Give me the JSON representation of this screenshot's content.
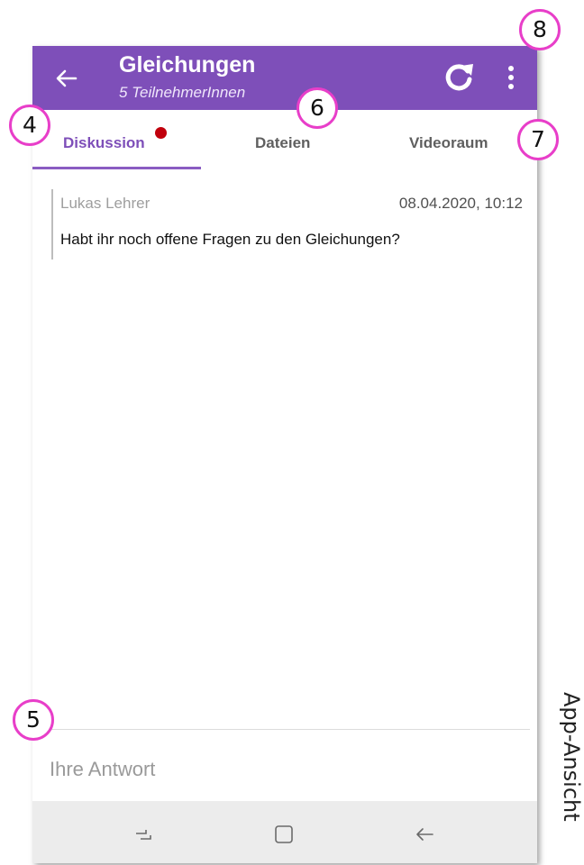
{
  "appbar": {
    "title": "Gleichungen",
    "subtitle": "5 TeilnehmerInnen",
    "back_icon": "arrow-left-icon",
    "refresh_icon": "refresh-icon",
    "more_icon": "more-vertical-icon",
    "color": "#7e4fb9"
  },
  "tabs": [
    {
      "label": "Diskussion",
      "active": true,
      "has_notification": true
    },
    {
      "label": "Dateien",
      "active": false
    },
    {
      "label": "Videoraum",
      "active": false
    }
  ],
  "colors": {
    "accent": "#7e4fb9",
    "notification_dot": "#c1000c",
    "callout_border": "#e83ec9"
  },
  "messages": [
    {
      "author": "Lukas Lehrer",
      "timestamp": "08.04.2020, 10:12",
      "text": "Habt ihr noch offene Fragen zu den Gleichungen?"
    }
  ],
  "reply": {
    "placeholder": "Ihre Antwort",
    "value": ""
  },
  "navbar": {
    "recents_icon": "recent-apps-icon",
    "home_icon": "home-icon",
    "back_icon": "back-arrow-icon"
  },
  "callouts": [
    "4",
    "5",
    "6",
    "7",
    "8"
  ],
  "side_label": "App-Ansicht"
}
